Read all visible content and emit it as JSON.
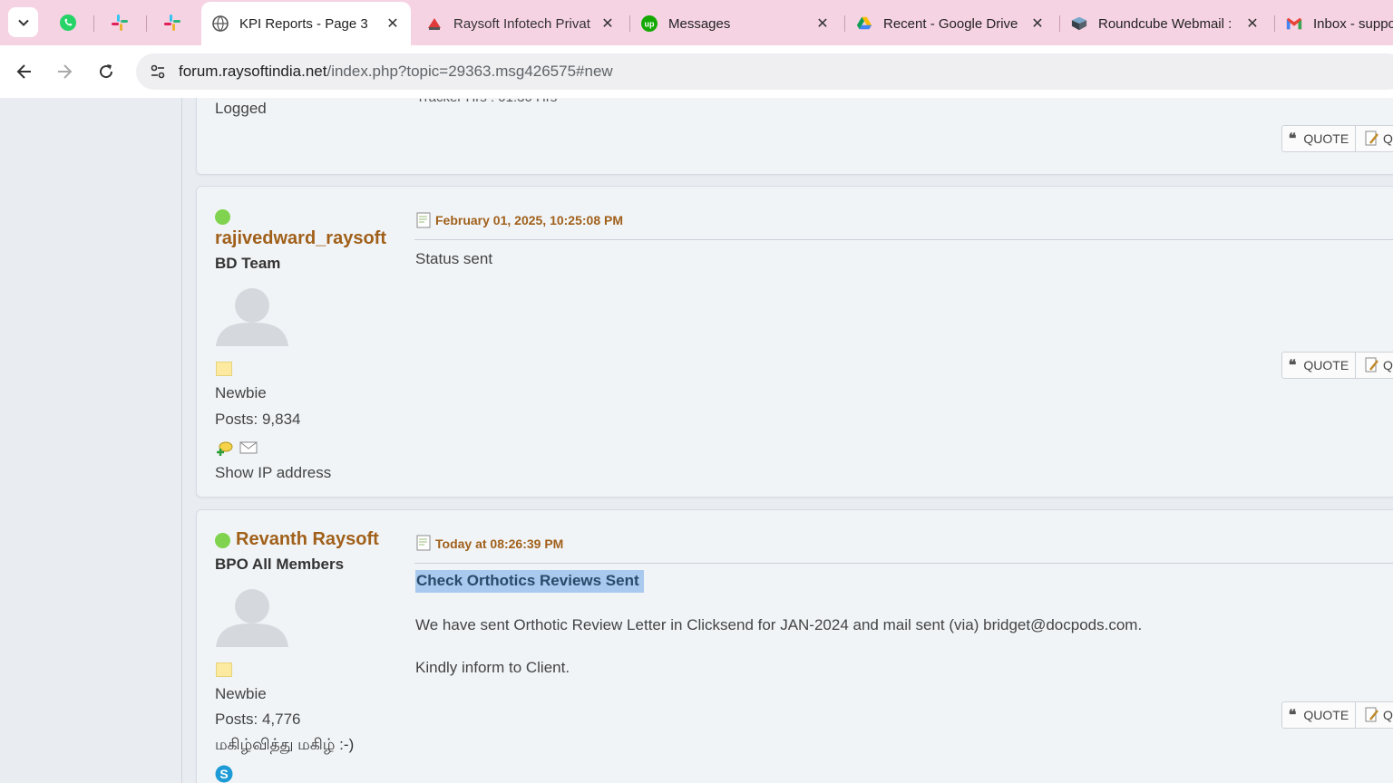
{
  "browser": {
    "tabs": [
      {
        "title": "KPI Reports - Page 3",
        "icon": "smf-icon",
        "active": true
      },
      {
        "title": "Raysoft Infotech Privat",
        "icon": "raysoft-icon",
        "active": false
      },
      {
        "title": "Messages",
        "icon": "upwork-icon",
        "active": false
      },
      {
        "title": "Recent - Google Drive",
        "icon": "google-drive-icon",
        "active": false
      },
      {
        "title": "Roundcube Webmail :",
        "icon": "roundcube-icon",
        "active": false
      },
      {
        "title": "Inbox - suppo",
        "icon": "gmail-icon",
        "active": false
      }
    ],
    "pinned_tabs": [
      "whatsapp-icon",
      "slack-icon",
      "slack-icon"
    ],
    "url_domain": "forum.raysoftindia.net",
    "url_path": "/index.php?topic=29363.msg426575#new"
  },
  "forum": {
    "prev_post": {
      "logged": "Logged",
      "cut_text": "Tracker Hrs : 01:30 Hrs",
      "quote_label": "QUOTE",
      "more_label": "Q"
    },
    "posts": [
      {
        "username": "rajivedward_raysoft",
        "group": "BD Team",
        "rank": "Newbie",
        "posts": "Posts: 9,834",
        "show_ip": "Show IP address",
        "date": "February 01, 2025, 10:25:08 PM",
        "body": "Status sent",
        "quote_label": "QUOTE",
        "more_label": "Q"
      },
      {
        "username": "Revanth Raysoft",
        "group": "BPO All Members",
        "rank": "Newbie",
        "posts": "Posts: 4,776",
        "signature": "மகிழ்வித்து மகிழ் :-)",
        "date": "Today at 08:26:39 PM",
        "subject": "Check Orthotics Reviews Sent",
        "body_line1": "We have sent Orthotic Review Letter in Clicksend for JAN-2024 and mail sent (via) bridget@docpods.com.",
        "body_line2": "Kindly inform to Client.",
        "quote_label": "QUOTE",
        "more_label": "Q"
      }
    ]
  },
  "colors": {
    "tabbar_bg": "#f6d3e3",
    "username": "#a0601a",
    "online": "#7fd34e",
    "selection": "#a9c9ee"
  }
}
